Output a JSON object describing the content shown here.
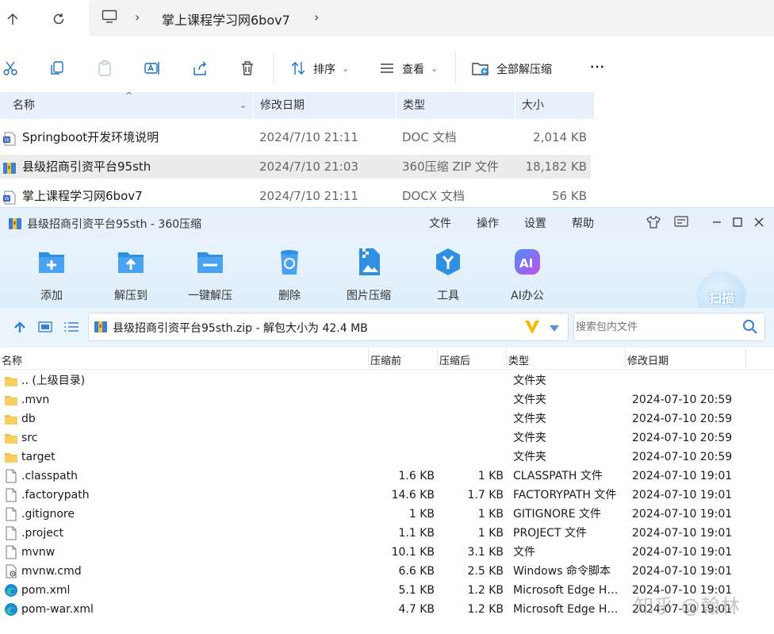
{
  "explorer": {
    "breadcrumb": [
      "掌上课程学习网6bov7"
    ],
    "toolbar": {
      "sort_label": "排序",
      "view_label": "查看",
      "extract_all_label": "全部解压缩",
      "more_label": "···"
    },
    "columns": [
      "名称",
      "修改日期",
      "类型",
      "大小"
    ],
    "files": [
      {
        "name": "Springboot开发环境说明",
        "date": "2024/7/10 21:11",
        "type": "DOC 文档",
        "size": "2,014 KB",
        "icon": "word-doc-icon"
      },
      {
        "name": "县级招商引资平台95sth",
        "date": "2024/7/10 21:03",
        "type": "360压缩 ZIP 文件",
        "size": "18,182 KB",
        "icon": "zip-archive-icon"
      },
      {
        "name": "掌上课程学习网6bov7",
        "date": "2024/7/10 21:11",
        "type": "DOCX 文档",
        "size": "56 KB",
        "icon": "word-docx-icon"
      }
    ]
  },
  "zip": {
    "window_title": "县级招商引资平台95sth - 360压缩",
    "menu": [
      "文件",
      "操作",
      "设置",
      "帮助"
    ],
    "tools": [
      {
        "label": "添加",
        "icon": "add-icon",
        "color": "#2f8fe0"
      },
      {
        "label": "解压到",
        "icon": "extract-to-icon",
        "color": "#2f8fe0"
      },
      {
        "label": "一键解压",
        "icon": "one-click-extract-icon",
        "color": "#2f8fe0"
      },
      {
        "label": "删除",
        "icon": "delete-icon",
        "color": "#2f8fe0"
      },
      {
        "label": "图片压缩",
        "icon": "image-compress-icon",
        "color": "#2f8fe0"
      },
      {
        "label": "工具",
        "icon": "tools-icon",
        "color": "#2f8fe0"
      },
      {
        "label": "AI办公",
        "icon": "ai-office-icon",
        "color": "#2f8fe0"
      }
    ],
    "scan_label": "扫描",
    "path_text": "县级招商引资平台95sth.zip - 解包大小为 42.4 MB",
    "search_placeholder": "搜索包内文件",
    "columns": [
      "名称",
      "压缩前",
      "压缩后",
      "类型",
      "修改日期"
    ],
    "rows": [
      {
        "name": ".. (上级目录)",
        "before": "",
        "after": "",
        "type": "文件夹",
        "date": "",
        "icon": "folder-icon"
      },
      {
        "name": ".mvn",
        "before": "",
        "after": "",
        "type": "文件夹",
        "date": "2024-07-10 20:59",
        "icon": "folder-icon"
      },
      {
        "name": "db",
        "before": "",
        "after": "",
        "type": "文件夹",
        "date": "2024-07-10 20:59",
        "icon": "folder-icon"
      },
      {
        "name": "src",
        "before": "",
        "after": "",
        "type": "文件夹",
        "date": "2024-07-10 20:59",
        "icon": "folder-icon"
      },
      {
        "name": "target",
        "before": "",
        "after": "",
        "type": "文件夹",
        "date": "2024-07-10 20:59",
        "icon": "folder-icon"
      },
      {
        "name": ".classpath",
        "before": "1.6 KB",
        "after": "1 KB",
        "type": "CLASSPATH 文件",
        "date": "2024-07-10 19:01",
        "icon": "file-icon"
      },
      {
        "name": ".factorypath",
        "before": "14.6 KB",
        "after": "1.7 KB",
        "type": "FACTORYPATH 文件",
        "date": "2024-07-10 19:01",
        "icon": "file-icon"
      },
      {
        "name": ".gitignore",
        "before": "1 KB",
        "after": "1 KB",
        "type": "GITIGNORE 文件",
        "date": "2024-07-10 19:01",
        "icon": "file-icon"
      },
      {
        "name": ".project",
        "before": "1.1 KB",
        "after": "1 KB",
        "type": "PROJECT 文件",
        "date": "2024-07-10 19:01",
        "icon": "file-icon"
      },
      {
        "name": "mvnw",
        "before": "10.1 KB",
        "after": "3.1 KB",
        "type": "文件",
        "date": "2024-07-10 19:01",
        "icon": "file-icon"
      },
      {
        "name": "mvnw.cmd",
        "before": "6.6 KB",
        "after": "2.5 KB",
        "type": "Windows 命令脚本",
        "date": "2024-07-10 19:01",
        "icon": "cmd-script-icon"
      },
      {
        "name": "pom.xml",
        "before": "5.1 KB",
        "after": "1.2 KB",
        "type": "Microsoft Edge HT...",
        "date": "2024-07-10 19:01",
        "icon": "edge-icon"
      },
      {
        "name": "pom-war.xml",
        "before": "4.7 KB",
        "after": "1.2 KB",
        "type": "Microsoft Edge HT...",
        "date": "2024-07-10 19:01",
        "icon": "edge-icon"
      }
    ]
  },
  "watermark": "知乎 @翰林"
}
